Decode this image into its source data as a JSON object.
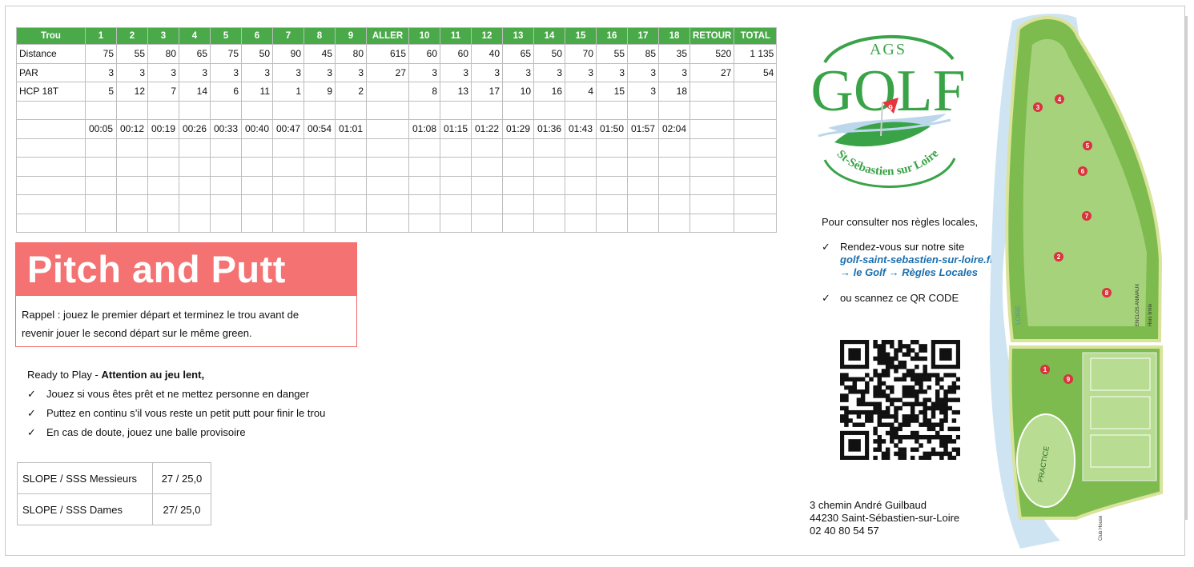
{
  "score_table": {
    "header": [
      "Trou",
      "1",
      "2",
      "3",
      "4",
      "5",
      "6",
      "7",
      "8",
      "9",
      "ALLER",
      "10",
      "11",
      "12",
      "13",
      "14",
      "15",
      "16",
      "17",
      "18",
      "RETOUR",
      "TOTAL"
    ],
    "rows": [
      [
        "Distance",
        "75",
        "55",
        "80",
        "65",
        "75",
        "50",
        "90",
        "45",
        "80",
        "615",
        "60",
        "60",
        "40",
        "65",
        "50",
        "70",
        "55",
        "85",
        "35",
        "520",
        "1 135"
      ],
      [
        "PAR",
        "3",
        "3",
        "3",
        "3",
        "3",
        "3",
        "3",
        "3",
        "3",
        "27",
        "3",
        "3",
        "3",
        "3",
        "3",
        "3",
        "3",
        "3",
        "3",
        "27",
        "54"
      ],
      [
        "HCP 18T",
        "5",
        "12",
        "7",
        "14",
        "6",
        "11",
        "1",
        "9",
        "2",
        "",
        "8",
        "13",
        "17",
        "10",
        "16",
        "4",
        "15",
        "3",
        "18",
        "",
        ""
      ],
      [
        "",
        "",
        "",
        "",
        "",
        "",
        "",
        "",
        "",
        "",
        "",
        "",
        "",
        "",
        "",
        "",
        "",
        "",
        "",
        "",
        "",
        ""
      ],
      [
        "",
        "00:05",
        "00:12",
        "00:19",
        "00:26",
        "00:33",
        "00:40",
        "00:47",
        "00:54",
        "01:01",
        "",
        "01:08",
        "01:15",
        "01:22",
        "01:29",
        "01:36",
        "01:43",
        "01:50",
        "01:57",
        "02:04",
        "",
        ""
      ],
      [
        "",
        "",
        "",
        "",
        "",
        "",
        "",
        "",
        "",
        "",
        "",
        "",
        "",
        "",
        "",
        "",
        "",
        "",
        "",
        "",
        "",
        ""
      ],
      [
        "",
        "",
        "",
        "",
        "",
        "",
        "",
        "",
        "",
        "",
        "",
        "",
        "",
        "",
        "",
        "",
        "",
        "",
        "",
        "",
        "",
        ""
      ],
      [
        "",
        "",
        "",
        "",
        "",
        "",
        "",
        "",
        "",
        "",
        "",
        "",
        "",
        "",
        "",
        "",
        "",
        "",
        "",
        "",
        "",
        ""
      ],
      [
        "",
        "",
        "",
        "",
        "",
        "",
        "",
        "",
        "",
        "",
        "",
        "",
        "",
        "",
        "",
        "",
        "",
        "",
        "",
        "",
        "",
        ""
      ],
      [
        "",
        "",
        "",
        "",
        "",
        "",
        "",
        "",
        "",
        "",
        "",
        "",
        "",
        "",
        "",
        "",
        "",
        "",
        "",
        "",
        "",
        ""
      ]
    ]
  },
  "pitch_and_putt": {
    "title": "Pitch and Putt",
    "line1": "Rappel : jouez le premier départ et terminez le trou avant de",
    "line2": "revenir jouer le second départ sur le même green."
  },
  "ready_to_play": {
    "intro": "Ready to Play - ",
    "intro_bold": "Attention au jeu lent,",
    "items": [
      "Jouez si vous êtes prêt et ne mettez personne en danger",
      "Puttez en continu s’il vous reste un petit putt pour finir le trou",
      "En cas de doute, jouez une balle provisoire"
    ],
    "check": "✓"
  },
  "slope": [
    {
      "label": "SLOPE / SSS Messieurs",
      "value": "27 / 25,0"
    },
    {
      "label": "SLOPE / SSS Dames",
      "value": "27/ 25,0"
    }
  ],
  "logo": {
    "top": "AGS",
    "main": "GOLF",
    "sub": "St-Sébastien sur Loire",
    "flag": "9"
  },
  "rules": {
    "intro": "Pour consulter nos règles locales,",
    "item1": "Rendez-vous sur notre site",
    "link": "golf-saint-sebastien-sur-loire.fr",
    "path": "→ le Golf → Règles Locales",
    "item2": "ou scannez ce QR CODE",
    "check": "✓"
  },
  "address": {
    "line1": "3 chemin André Guilbaud",
    "line2": "44230 Saint-Sébastien-sur-Loire",
    "line3": "02 40 80 54 57"
  },
  "map": {
    "river": "LOIRE",
    "enclos": "ENCLOS ANIMAUX",
    "hors_limite": "Hors limite",
    "practice": "PRACTICE",
    "club_house": "Club House",
    "holes": [
      "1",
      "2",
      "3",
      "4",
      "5",
      "6",
      "7",
      "8",
      "9"
    ]
  },
  "colors": {
    "green": "#4aaa4a",
    "coral": "#f47272",
    "link": "#1a6fb0"
  }
}
